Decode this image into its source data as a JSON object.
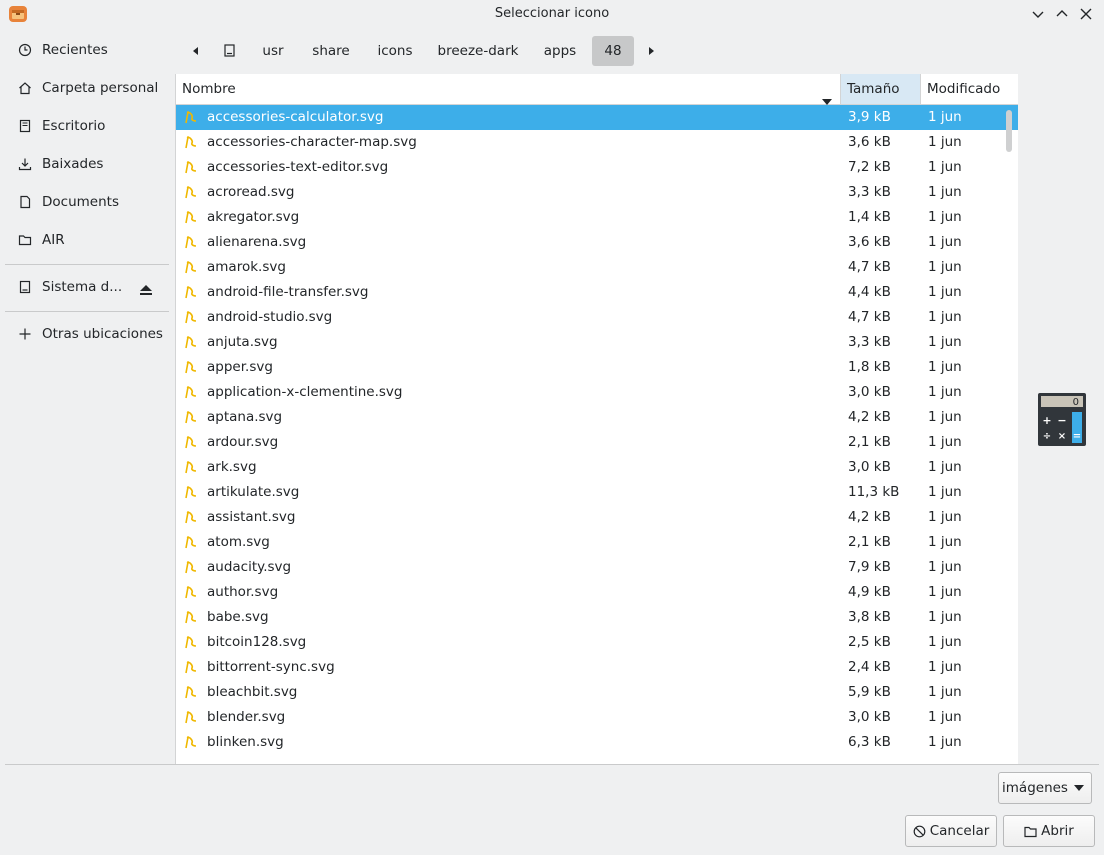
{
  "window": {
    "title": "Seleccionar icono",
    "app_icon": "package-icon"
  },
  "sidebar": {
    "items": [
      {
        "label": "Recientes",
        "icon": "clock-icon"
      },
      {
        "label": "Carpeta personal",
        "icon": "home-icon"
      },
      {
        "label": "Escritorio",
        "icon": "desktop-icon"
      },
      {
        "label": "Baixades",
        "icon": "download-icon"
      },
      {
        "label": "Documents",
        "icon": "document-icon"
      },
      {
        "label": "AIR",
        "icon": "folder-icon"
      }
    ],
    "device": {
      "label": "Sistema d...",
      "icon": "drive-icon"
    },
    "other": {
      "label": "Otras ubicaciones",
      "icon": "plus-icon"
    }
  },
  "pathbar": {
    "crumbs": [
      "usr",
      "share",
      "icons",
      "breeze-dark",
      "apps",
      "48"
    ],
    "active_index": 5
  },
  "columns": {
    "name": "Nombre",
    "size": "Tamaño",
    "modified": "Modificado"
  },
  "files": [
    {
      "name": "accessories-calculator.svg",
      "size": "3,9 kB",
      "date": "1 jun"
    },
    {
      "name": "accessories-character-map.svg",
      "size": "3,6 kB",
      "date": "1 jun"
    },
    {
      "name": "accessories-text-editor.svg",
      "size": "7,2 kB",
      "date": "1 jun"
    },
    {
      "name": "acroread.svg",
      "size": "3,3 kB",
      "date": "1 jun"
    },
    {
      "name": "akregator.svg",
      "size": "1,4 kB",
      "date": "1 jun"
    },
    {
      "name": "alienarena.svg",
      "size": "3,6 kB",
      "date": "1 jun"
    },
    {
      "name": "amarok.svg",
      "size": "4,7 kB",
      "date": "1 jun"
    },
    {
      "name": "android-file-transfer.svg",
      "size": "4,4 kB",
      "date": "1 jun"
    },
    {
      "name": "android-studio.svg",
      "size": "4,7 kB",
      "date": "1 jun"
    },
    {
      "name": "anjuta.svg",
      "size": "3,3 kB",
      "date": "1 jun"
    },
    {
      "name": "apper.svg",
      "size": "1,8 kB",
      "date": "1 jun"
    },
    {
      "name": "application-x-clementine.svg",
      "size": "3,0 kB",
      "date": "1 jun"
    },
    {
      "name": "aptana.svg",
      "size": "4,2 kB",
      "date": "1 jun"
    },
    {
      "name": "ardour.svg",
      "size": "2,1 kB",
      "date": "1 jun"
    },
    {
      "name": "ark.svg",
      "size": "3,0 kB",
      "date": "1 jun"
    },
    {
      "name": "artikulate.svg",
      "size": "11,3 kB",
      "date": "1 jun"
    },
    {
      "name": "assistant.svg",
      "size": "4,2 kB",
      "date": "1 jun"
    },
    {
      "name": "atom.svg",
      "size": "2,1 kB",
      "date": "1 jun"
    },
    {
      "name": "audacity.svg",
      "size": "7,9 kB",
      "date": "1 jun"
    },
    {
      "name": "author.svg",
      "size": "4,9 kB",
      "date": "1 jun"
    },
    {
      "name": "babe.svg",
      "size": "3,8 kB",
      "date": "1 jun"
    },
    {
      "name": "bitcoin128.svg",
      "size": "2,5 kB",
      "date": "1 jun"
    },
    {
      "name": "bittorrent-sync.svg",
      "size": "2,4 kB",
      "date": "1 jun"
    },
    {
      "name": "bleachbit.svg",
      "size": "5,9 kB",
      "date": "1 jun"
    },
    {
      "name": "blender.svg",
      "size": "3,0 kB",
      "date": "1 jun"
    },
    {
      "name": "blinken.svg",
      "size": "6,3 kB",
      "date": "1 jun"
    }
  ],
  "selected_index": 0,
  "preview": {
    "icon": "calculator-icon",
    "display": "0",
    "keys": [
      "+",
      "−",
      "÷",
      "×",
      "="
    ]
  },
  "filter": {
    "label": "imágenes"
  },
  "buttons": {
    "cancel": "Cancelar",
    "open": "Abrir"
  },
  "colors": {
    "accent": "#3daee9",
    "background": "#eff0f1",
    "file_icon": "#f0b800"
  }
}
